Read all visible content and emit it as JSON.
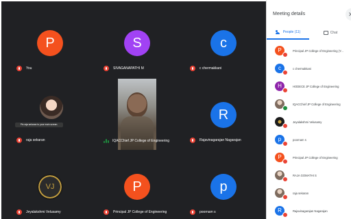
{
  "grid": {
    "tiles": [
      {
        "name": "You",
        "initial": "P",
        "color": "#f4511e"
      },
      {
        "name": "SIVAGANAPATHI M",
        "initial": "S",
        "color": "#a142f4"
      },
      {
        "name": "c chermakkani",
        "initial": "c",
        "color": "#1a73e8"
      },
      {
        "name": "raja sekaran",
        "tooltip": "Pin raja sekaran to your main screen."
      },
      {
        "name": "IQACChief JP College of Engineering"
      },
      {
        "name": "Rajavinagarajan Nagarajan",
        "initial": "R",
        "color": "#1a73e8"
      },
      {
        "name": "Jeyalakshmi Velusamy",
        "logo": "VJ"
      },
      {
        "name": "Principal JP College of Engineering",
        "initial": "P",
        "color": "#f4511e"
      },
      {
        "name": "poornam s",
        "initial": "p",
        "color": "#1a73e8"
      }
    ]
  },
  "panel": {
    "title": "Meeting details",
    "tabs": {
      "people": "People (11)",
      "chat": "Chat"
    },
    "people": [
      {
        "name": "Principal JP College of Engineering (Y...",
        "initial": "P",
        "color": "#f4511e"
      },
      {
        "name": "c chermakkani",
        "initial": "c",
        "color": "#1a73e8"
      },
      {
        "name": "HODECE JP College of Engineering",
        "initial": "H",
        "color": "#8e24aa"
      },
      {
        "name": "IQACChief JP College of Engineering",
        "initial": "",
        "color": "#9e9e9e"
      },
      {
        "name": "Jeyalakshmi Velusamy",
        "initial": "",
        "color": "#202124"
      },
      {
        "name": "poornam s",
        "initial": "p",
        "color": "#1a73e8"
      },
      {
        "name": "Principal JP College of Engineering",
        "initial": "P",
        "color": "#f4511e"
      },
      {
        "name": "RAJA GOMATHI S",
        "initial": "",
        "color": "#bdbdbd"
      },
      {
        "name": "raja sekaran",
        "initial": "",
        "color": "#bdbdbd"
      },
      {
        "name": "Rajavinagarajan Nagarajan",
        "initial": "R",
        "color": "#1a73e8"
      }
    ]
  }
}
